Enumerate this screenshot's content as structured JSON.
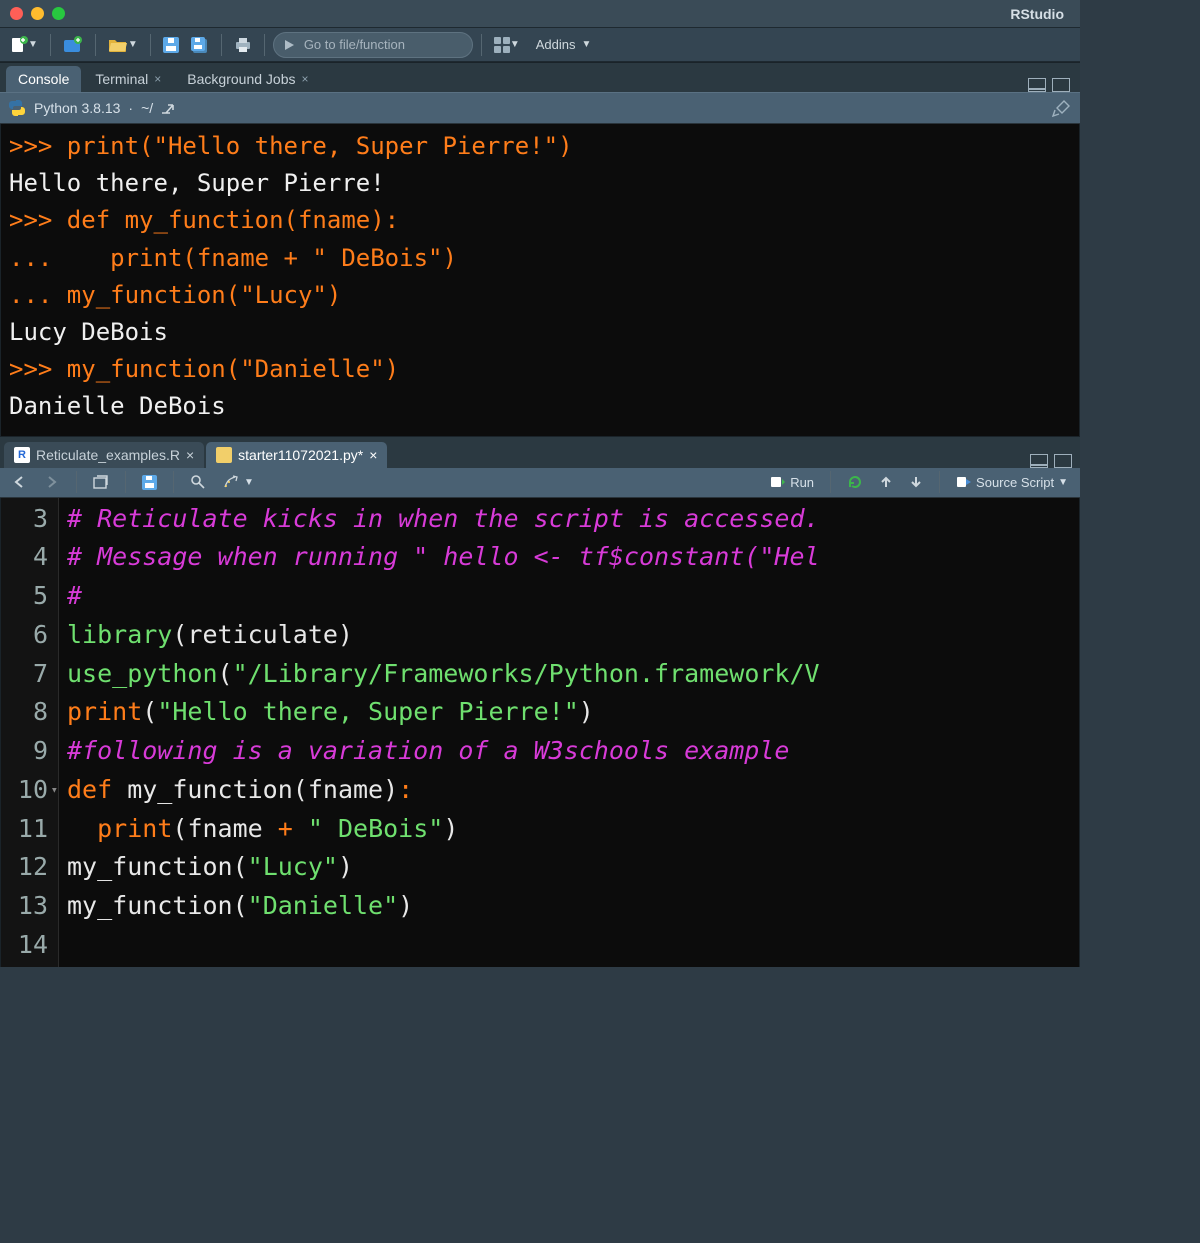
{
  "app": {
    "title": "RStudio"
  },
  "toolbar": {
    "gotofile_placeholder": "Go to file/function",
    "addins_label": "Addins"
  },
  "console_pane": {
    "tabs": [
      {
        "label": "Console",
        "closable": false
      },
      {
        "label": "Terminal",
        "closable": true
      },
      {
        "label": "Background Jobs",
        "closable": true
      }
    ],
    "header": {
      "engine": "Python 3.8.13",
      "path": "~/"
    },
    "lines": [
      {
        "type": "prompt",
        "prompt": ">>>",
        "code": "print(\"Hello there, Super Pierre!\")"
      },
      {
        "type": "output",
        "text": "Hello there, Super Pierre!"
      },
      {
        "type": "prompt",
        "prompt": ">>>",
        "code": "def my_function(fname):"
      },
      {
        "type": "prompt",
        "prompt": "...",
        "code": "   print(fname + \" DeBois\")"
      },
      {
        "type": "prompt",
        "prompt": "...",
        "code": "my_function(\"Lucy\")"
      },
      {
        "type": "output",
        "text": "Lucy DeBois"
      },
      {
        "type": "prompt",
        "prompt": ">>>",
        "code": "my_function(\"Danielle\")"
      },
      {
        "type": "output",
        "text": "Danielle DeBois"
      }
    ]
  },
  "editor_pane": {
    "file_tabs": [
      {
        "label": "Reticulate_examples.R",
        "icon": "R",
        "active": false
      },
      {
        "label": "starter11072021.py*",
        "icon": "PY",
        "active": true
      }
    ],
    "toolbar": {
      "run_label": "Run",
      "source_label": "Source Script"
    },
    "first_line_no": 3,
    "lines": [
      {
        "n": 3,
        "tokens": [
          {
            "cls": "cm-comment",
            "t": "# Reticulate kicks in when the script is accessed."
          }
        ]
      },
      {
        "n": 4,
        "tokens": [
          {
            "cls": "cm-comment",
            "t": "# Message when running \" hello <- tf$constant(\"Hel"
          }
        ]
      },
      {
        "n": 5,
        "tokens": [
          {
            "cls": "cm-comment",
            "t": "#"
          }
        ]
      },
      {
        "n": 6,
        "tokens": [
          {
            "cls": "cm-func",
            "t": "library"
          },
          {
            "cls": "cm-paren",
            "t": "(reticulate)"
          }
        ]
      },
      {
        "n": 7,
        "tokens": [
          {
            "cls": "cm-func",
            "t": "use_python"
          },
          {
            "cls": "cm-paren",
            "t": "("
          },
          {
            "cls": "cm-string",
            "t": "\"/Library/Frameworks/Python.framework/V"
          }
        ]
      },
      {
        "n": 8,
        "tokens": [
          {
            "cls": "cm-print",
            "t": "print"
          },
          {
            "cls": "cm-paren",
            "t": "("
          },
          {
            "cls": "cm-string",
            "t": "\"Hello there, Super Pierre!\""
          },
          {
            "cls": "cm-paren",
            "t": ")"
          }
        ]
      },
      {
        "n": 9,
        "tokens": [
          {
            "cls": "cm-comment",
            "t": "#following is a variation of a W3schools example"
          }
        ]
      },
      {
        "n": 10,
        "fold": true,
        "tokens": [
          {
            "cls": "cm-kw",
            "t": "def"
          },
          {
            "cls": "cm-name",
            "t": " my_function"
          },
          {
            "cls": "cm-paren",
            "t": "("
          },
          {
            "cls": "cm-name",
            "t": "fname"
          },
          {
            "cls": "cm-paren",
            "t": ")"
          },
          {
            "cls": "cm-op",
            "t": ":"
          }
        ]
      },
      {
        "n": 11,
        "tokens": [
          {
            "cls": "cm-name",
            "t": "  "
          },
          {
            "cls": "cm-print",
            "t": "print"
          },
          {
            "cls": "cm-paren",
            "t": "("
          },
          {
            "cls": "cm-name",
            "t": "fname"
          },
          {
            "cls": "cm-op",
            "t": " + "
          },
          {
            "cls": "cm-string",
            "t": "\" DeBois\""
          },
          {
            "cls": "cm-paren",
            "t": ")"
          }
        ]
      },
      {
        "n": 12,
        "tokens": [
          {
            "cls": "cm-name",
            "t": ""
          }
        ]
      },
      {
        "n": 13,
        "tokens": [
          {
            "cls": "cm-name",
            "t": "my_function"
          },
          {
            "cls": "cm-paren",
            "t": "("
          },
          {
            "cls": "cm-string",
            "t": "\"Lucy\""
          },
          {
            "cls": "cm-paren",
            "t": ")"
          }
        ]
      },
      {
        "n": 14,
        "tokens": [
          {
            "cls": "cm-name",
            "t": "my_function"
          },
          {
            "cls": "cm-paren",
            "t": "("
          },
          {
            "cls": "cm-string",
            "t": "\"Danielle\""
          },
          {
            "cls": "cm-paren",
            "t": ")"
          }
        ]
      }
    ]
  }
}
